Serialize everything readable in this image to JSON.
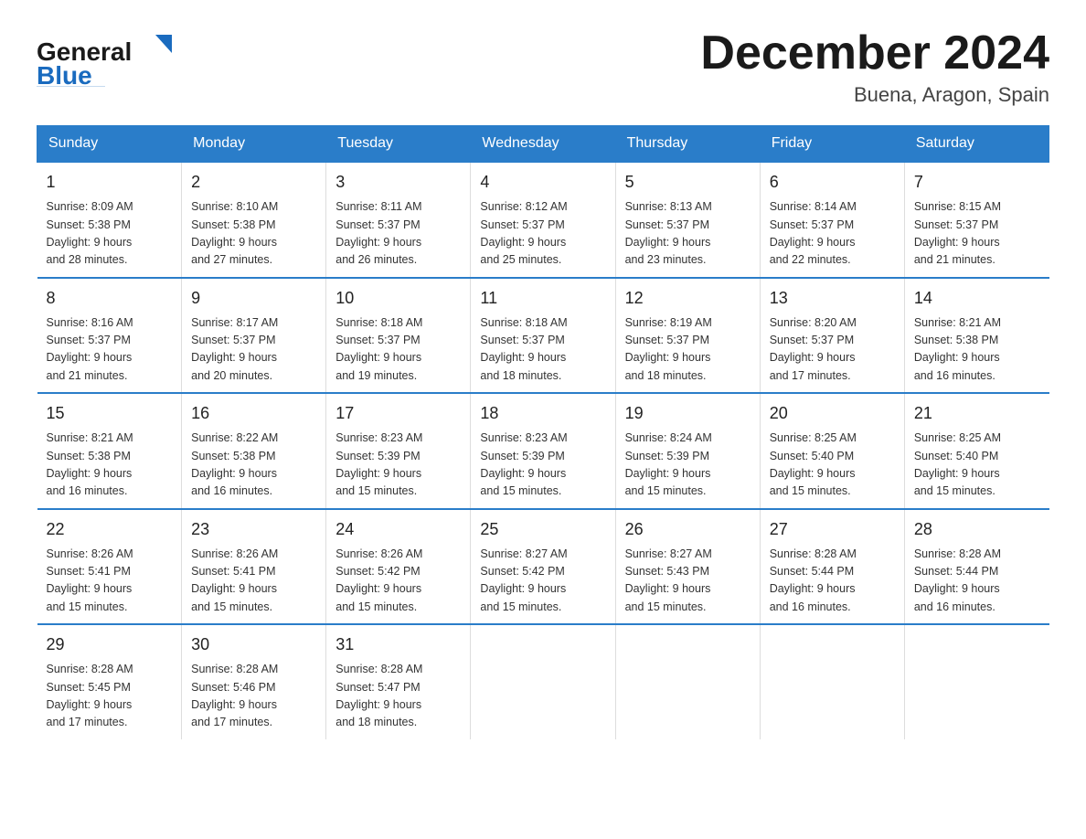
{
  "header": {
    "logo": {
      "general": "General",
      "blue": "Blue",
      "alt": "GeneralBlue"
    },
    "title": "December 2024",
    "subtitle": "Buena, Aragon, Spain"
  },
  "weekdays": [
    "Sunday",
    "Monday",
    "Tuesday",
    "Wednesday",
    "Thursday",
    "Friday",
    "Saturday"
  ],
  "weeks": [
    [
      {
        "day": "1",
        "sunrise": "8:09 AM",
        "sunset": "5:38 PM",
        "daylight": "9 hours and 28 minutes."
      },
      {
        "day": "2",
        "sunrise": "8:10 AM",
        "sunset": "5:38 PM",
        "daylight": "9 hours and 27 minutes."
      },
      {
        "day": "3",
        "sunrise": "8:11 AM",
        "sunset": "5:37 PM",
        "daylight": "9 hours and 26 minutes."
      },
      {
        "day": "4",
        "sunrise": "8:12 AM",
        "sunset": "5:37 PM",
        "daylight": "9 hours and 25 minutes."
      },
      {
        "day": "5",
        "sunrise": "8:13 AM",
        "sunset": "5:37 PM",
        "daylight": "9 hours and 23 minutes."
      },
      {
        "day": "6",
        "sunrise": "8:14 AM",
        "sunset": "5:37 PM",
        "daylight": "9 hours and 22 minutes."
      },
      {
        "day": "7",
        "sunrise": "8:15 AM",
        "sunset": "5:37 PM",
        "daylight": "9 hours and 21 minutes."
      }
    ],
    [
      {
        "day": "8",
        "sunrise": "8:16 AM",
        "sunset": "5:37 PM",
        "daylight": "9 hours and 21 minutes."
      },
      {
        "day": "9",
        "sunrise": "8:17 AM",
        "sunset": "5:37 PM",
        "daylight": "9 hours and 20 minutes."
      },
      {
        "day": "10",
        "sunrise": "8:18 AM",
        "sunset": "5:37 PM",
        "daylight": "9 hours and 19 minutes."
      },
      {
        "day": "11",
        "sunrise": "8:18 AM",
        "sunset": "5:37 PM",
        "daylight": "9 hours and 18 minutes."
      },
      {
        "day": "12",
        "sunrise": "8:19 AM",
        "sunset": "5:37 PM",
        "daylight": "9 hours and 18 minutes."
      },
      {
        "day": "13",
        "sunrise": "8:20 AM",
        "sunset": "5:37 PM",
        "daylight": "9 hours and 17 minutes."
      },
      {
        "day": "14",
        "sunrise": "8:21 AM",
        "sunset": "5:38 PM",
        "daylight": "9 hours and 16 minutes."
      }
    ],
    [
      {
        "day": "15",
        "sunrise": "8:21 AM",
        "sunset": "5:38 PM",
        "daylight": "9 hours and 16 minutes."
      },
      {
        "day": "16",
        "sunrise": "8:22 AM",
        "sunset": "5:38 PM",
        "daylight": "9 hours and 16 minutes."
      },
      {
        "day": "17",
        "sunrise": "8:23 AM",
        "sunset": "5:39 PM",
        "daylight": "9 hours and 15 minutes."
      },
      {
        "day": "18",
        "sunrise": "8:23 AM",
        "sunset": "5:39 PM",
        "daylight": "9 hours and 15 minutes."
      },
      {
        "day": "19",
        "sunrise": "8:24 AM",
        "sunset": "5:39 PM",
        "daylight": "9 hours and 15 minutes."
      },
      {
        "day": "20",
        "sunrise": "8:25 AM",
        "sunset": "5:40 PM",
        "daylight": "9 hours and 15 minutes."
      },
      {
        "day": "21",
        "sunrise": "8:25 AM",
        "sunset": "5:40 PM",
        "daylight": "9 hours and 15 minutes."
      }
    ],
    [
      {
        "day": "22",
        "sunrise": "8:26 AM",
        "sunset": "5:41 PM",
        "daylight": "9 hours and 15 minutes."
      },
      {
        "day": "23",
        "sunrise": "8:26 AM",
        "sunset": "5:41 PM",
        "daylight": "9 hours and 15 minutes."
      },
      {
        "day": "24",
        "sunrise": "8:26 AM",
        "sunset": "5:42 PM",
        "daylight": "9 hours and 15 minutes."
      },
      {
        "day": "25",
        "sunrise": "8:27 AM",
        "sunset": "5:42 PM",
        "daylight": "9 hours and 15 minutes."
      },
      {
        "day": "26",
        "sunrise": "8:27 AM",
        "sunset": "5:43 PM",
        "daylight": "9 hours and 15 minutes."
      },
      {
        "day": "27",
        "sunrise": "8:28 AM",
        "sunset": "5:44 PM",
        "daylight": "9 hours and 16 minutes."
      },
      {
        "day": "28",
        "sunrise": "8:28 AM",
        "sunset": "5:44 PM",
        "daylight": "9 hours and 16 minutes."
      }
    ],
    [
      {
        "day": "29",
        "sunrise": "8:28 AM",
        "sunset": "5:45 PM",
        "daylight": "9 hours and 17 minutes."
      },
      {
        "day": "30",
        "sunrise": "8:28 AM",
        "sunset": "5:46 PM",
        "daylight": "9 hours and 17 minutes."
      },
      {
        "day": "31",
        "sunrise": "8:28 AM",
        "sunset": "5:47 PM",
        "daylight": "9 hours and 18 minutes."
      },
      {
        "day": "",
        "sunrise": "",
        "sunset": "",
        "daylight": ""
      },
      {
        "day": "",
        "sunrise": "",
        "sunset": "",
        "daylight": ""
      },
      {
        "day": "",
        "sunrise": "",
        "sunset": "",
        "daylight": ""
      },
      {
        "day": "",
        "sunrise": "",
        "sunset": "",
        "daylight": ""
      }
    ]
  ],
  "labels": {
    "sunrise": "Sunrise:",
    "sunset": "Sunset:",
    "daylight": "Daylight:"
  }
}
